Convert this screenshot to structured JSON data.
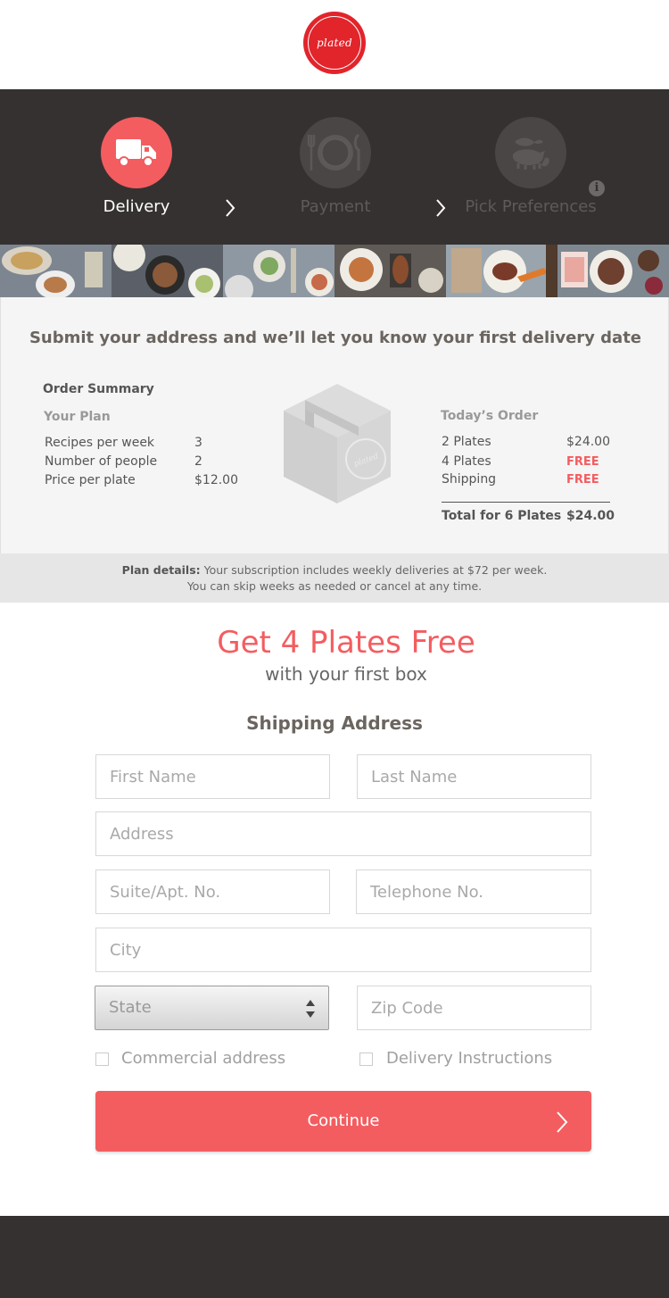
{
  "brand": {
    "logo_text": "plated",
    "accent": "#f35d60",
    "logo_red": "#e2242b",
    "dark": "#353131"
  },
  "steps": [
    {
      "label": "Delivery",
      "state": "active",
      "icon": "truck-icon"
    },
    {
      "label": "Payment",
      "state": "inactive",
      "icon": "plate-fork-knife-icon"
    },
    {
      "label": "Pick Preferences",
      "state": "inactive",
      "icon": "animals-icon"
    }
  ],
  "summary": {
    "headline": "Submit your address and we’ll let you know your first delivery date",
    "order_summary_title": "Order Summary",
    "your_plan": {
      "title": "Your Plan",
      "rows": [
        {
          "label": "Recipes per week",
          "value": "3"
        },
        {
          "label": "Number of people",
          "value": "2"
        },
        {
          "label": "Price per plate",
          "value": "$12.00"
        }
      ]
    },
    "box_logo_text": "plated",
    "todays_order": {
      "title": "Today’s Order",
      "rows": [
        {
          "label": "2 Plates",
          "value": "$24.00"
        },
        {
          "label": "4 Plates",
          "value": "FREE"
        },
        {
          "label": "Shipping",
          "value": "FREE"
        }
      ],
      "total_label": "Total for 6 Plates",
      "total_value": "$24.00"
    }
  },
  "plan_details": {
    "label": "Plan details:",
    "line1": " Your subscription includes weekly deliveries at $72 per week.",
    "line2": "You can skip weeks as needed or cancel at any time."
  },
  "promo": {
    "title": "Get 4 Plates Free",
    "subtitle": "with your first box"
  },
  "form": {
    "title": "Shipping Address",
    "first_name": {
      "placeholder": "First Name",
      "value": ""
    },
    "last_name": {
      "placeholder": "Last Name",
      "value": ""
    },
    "address": {
      "placeholder": "Address",
      "value": ""
    },
    "suite": {
      "placeholder": "Suite/Apt. No.",
      "value": ""
    },
    "telephone": {
      "placeholder": "Telephone No.",
      "value": ""
    },
    "city": {
      "placeholder": "City",
      "value": ""
    },
    "state": {
      "selected": "State"
    },
    "zip": {
      "placeholder": "Zip Code",
      "value": ""
    },
    "commercial_label": "Commercial address",
    "delivery_instructions_label": "Delivery Instructions",
    "continue_label": "Continue"
  }
}
